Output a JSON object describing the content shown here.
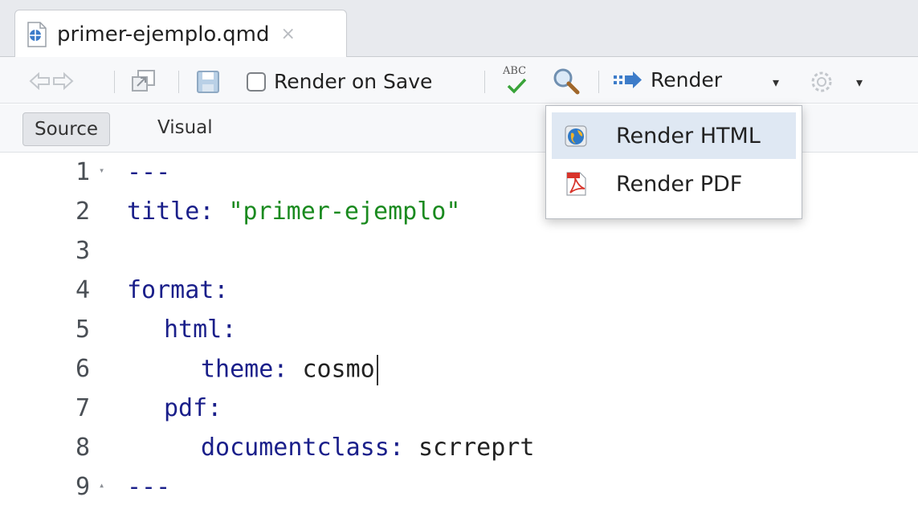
{
  "tab": {
    "filename": "primer-ejemplo.qmd",
    "close_glyph": "×"
  },
  "toolbar": {
    "render_on_save_label": "Render on Save",
    "render_on_save_checked": false,
    "spellcheck_abc": "ABC",
    "render_label": "Render"
  },
  "modes": {
    "source_label": "Source",
    "visual_label": "Visual"
  },
  "editor": {
    "lines": [
      {
        "num": "1",
        "fold": "▾"
      },
      {
        "num": "2"
      },
      {
        "num": "3"
      },
      {
        "num": "4"
      },
      {
        "num": "5"
      },
      {
        "num": "6"
      },
      {
        "num": "7"
      },
      {
        "num": "8"
      },
      {
        "num": "9",
        "fold": "▴"
      }
    ],
    "code": {
      "l1": "---",
      "l2_key": "title",
      "l2_colon": ": ",
      "l2_val": "\"primer-ejemplo\"",
      "l4_key": "format",
      "l4_colon": ":",
      "l5_key": "html",
      "l5_colon": ":",
      "l6_key": "theme",
      "l6_colon": ": ",
      "l6_val": "cosmo",
      "l7_key": "pdf",
      "l7_colon": ":",
      "l8_key": "documentclass",
      "l8_colon": ": ",
      "l8_val": "scrreprt",
      "l9": "---"
    }
  },
  "render_menu": {
    "items": [
      {
        "label": "Render HTML",
        "icon": "globe-icon",
        "highlighted": true
      },
      {
        "label": "Render PDF",
        "icon": "pdf-icon",
        "highlighted": false
      }
    ]
  },
  "colors": {
    "yaml_key": "#1a1f8a",
    "yaml_string": "#1a8a1f",
    "menu_highlight": "#dfe8f3"
  }
}
